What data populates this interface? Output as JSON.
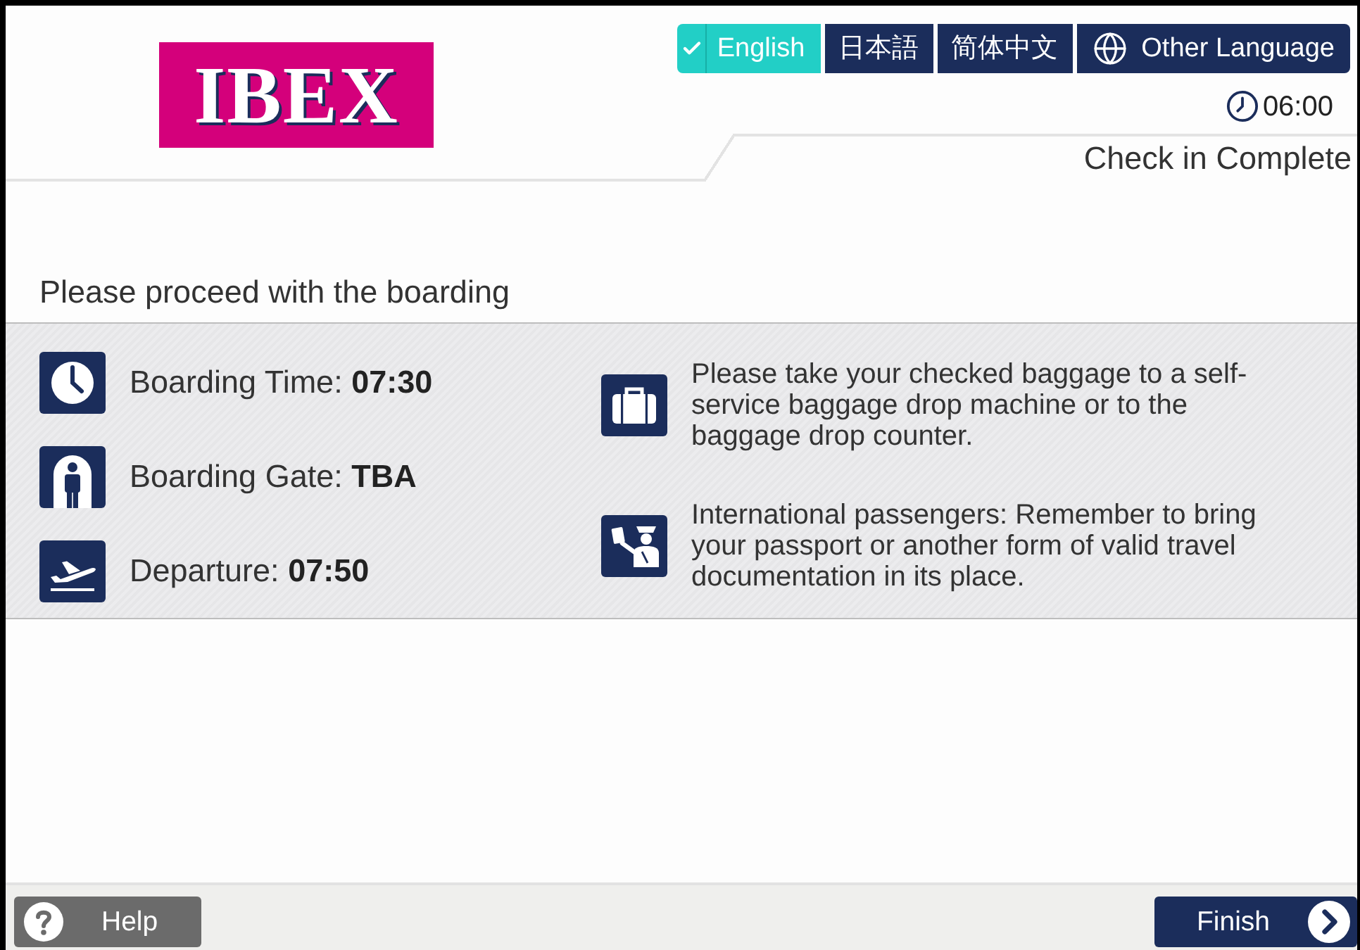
{
  "header": {
    "logo": "IBEX",
    "languages": [
      {
        "label": "English",
        "selected": true,
        "kind": "language"
      },
      {
        "label": "日本語",
        "selected": false,
        "kind": "language"
      },
      {
        "label": "简体中文",
        "selected": false,
        "kind": "language"
      },
      {
        "label": "Other Language",
        "selected": false,
        "kind": "more"
      }
    ],
    "clock": "06:00",
    "step_title": "Check in Complete"
  },
  "message": "Please proceed with the boarding",
  "flight_info": [
    {
      "kind": "time",
      "text": "Boarding Time: **07:30**"
    },
    {
      "kind": "gate",
      "text": "Boarding Gate: **TBA**"
    },
    {
      "kind": "departure",
      "text": "Departure: **07:50**"
    }
  ],
  "notices": [
    {
      "kind": "baggage",
      "text": "Please take your checked baggage to a self-service baggage drop machine or to the baggage drop counter."
    },
    {
      "kind": "passport",
      "text": "International passengers: Remember to bring your passport or another form of valid travel documentation in its place."
    }
  ],
  "footer": {
    "help": "Help",
    "finish": "Finish"
  }
}
